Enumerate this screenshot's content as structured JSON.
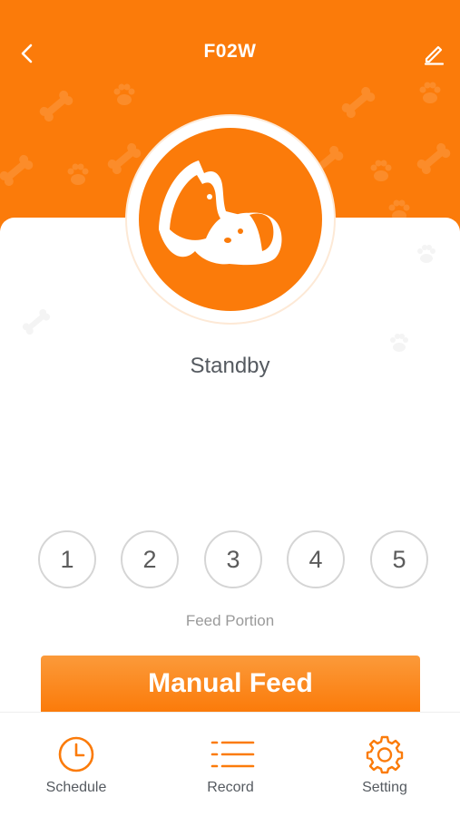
{
  "header": {
    "title": "F02W",
    "back_icon": "chevron-left-icon",
    "edit_icon": "pencil-icon",
    "background_color": "#fb7b0a"
  },
  "device": {
    "logo_icon": "cat-and-dog-logo",
    "status": "Standby"
  },
  "portions": {
    "options": [
      "1",
      "2",
      "3",
      "4",
      "5"
    ],
    "label": "Feed Portion"
  },
  "actions": {
    "manual_feed": "Manual Feed"
  },
  "tabbar": {
    "items": [
      {
        "label": "Schedule",
        "icon": "clock-icon"
      },
      {
        "label": "Record",
        "icon": "list-icon"
      },
      {
        "label": "Setting",
        "icon": "gear-icon"
      }
    ],
    "accent_color": "#fb7b0a"
  }
}
